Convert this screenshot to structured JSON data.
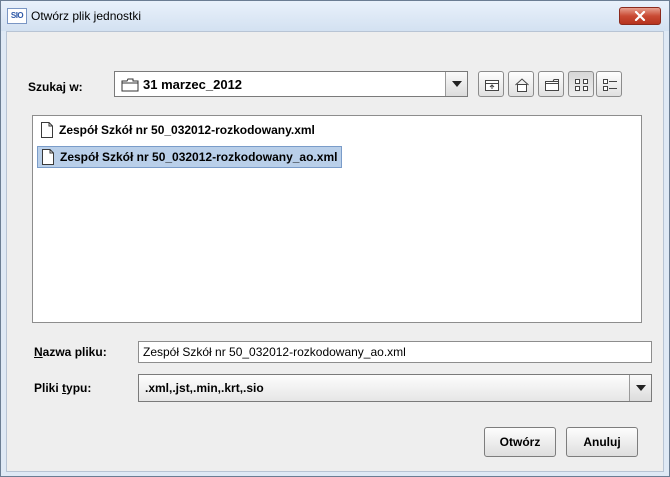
{
  "window": {
    "app_icon_text": "SIO",
    "title": "Otwórz plik jednostki"
  },
  "lookin": {
    "label": "Szukaj w:",
    "value": "31 marzec_2012"
  },
  "toolbar": {
    "icons": [
      "up-folder-icon",
      "home-icon",
      "new-folder-icon",
      "list-view-icon",
      "details-view-icon"
    ]
  },
  "files": [
    {
      "name": "Zespół Szkół nr 50_032012-rozkodowany.xml",
      "selected": false
    },
    {
      "name": "Zespół Szkół nr 50_032012-rozkodowany_ao.xml",
      "selected": true
    }
  ],
  "filename": {
    "label_mnemonic": "N",
    "label_rest": "azwa pliku:",
    "value": "Zespół Szkół nr 50_032012-rozkodowany_ao.xml"
  },
  "filetype": {
    "label_pre": "Pliki ",
    "label_mnemonic": "t",
    "label_post": "ypu:",
    "value": ".xml,.jst,.min,.krt,.sio"
  },
  "buttons": {
    "open": "Otwórz",
    "cancel": "Anuluj"
  },
  "colors": {
    "selection": "#b9cfe9",
    "close_button": "#c94a34",
    "title_bar": "#dfe9f5"
  }
}
